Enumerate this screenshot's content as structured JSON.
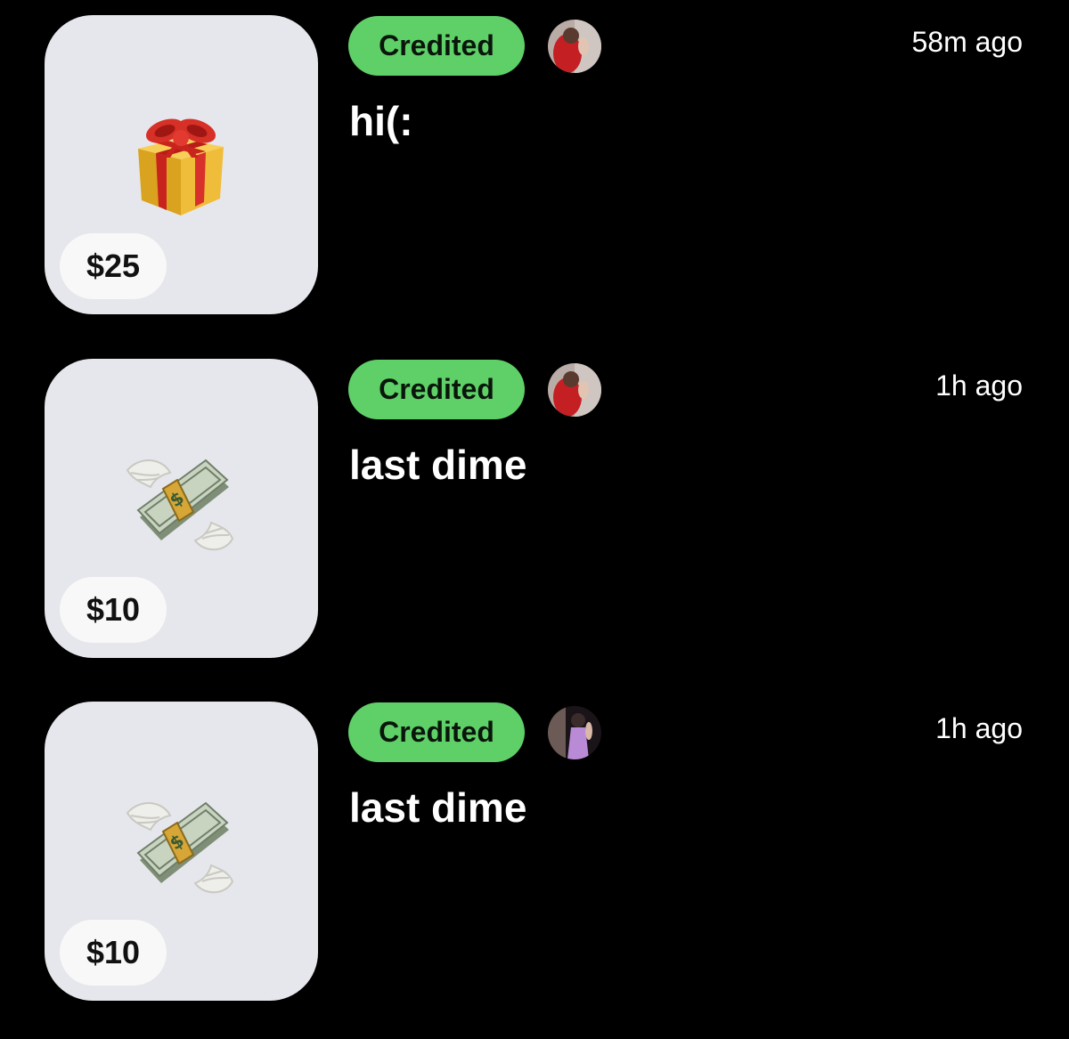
{
  "transactions": [
    {
      "amount": "$25",
      "icon": "gift-icon",
      "status": "Credited",
      "time": "58m ago",
      "message": "hi(:",
      "status_color": "#5fd068",
      "avatar_accent": "#c41f22"
    },
    {
      "amount": "$10",
      "icon": "money-with-wings-icon",
      "status": "Credited",
      "time": "1h ago",
      "message": "last dime",
      "status_color": "#5fd068",
      "avatar_accent": "#c41f22"
    },
    {
      "amount": "$10",
      "icon": "money-with-wings-icon",
      "status": "Credited",
      "time": "1h ago",
      "message": "last dime",
      "status_color": "#5fd068",
      "avatar_accent": "#b98ad6"
    }
  ]
}
